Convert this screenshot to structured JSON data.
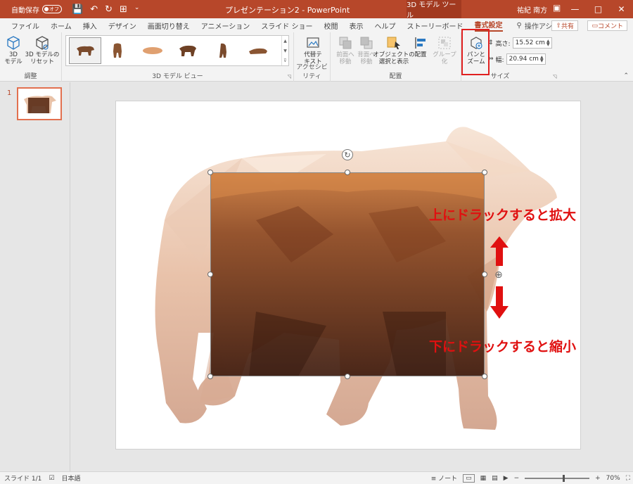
{
  "titlebar": {
    "autosave_label": "自動保存",
    "autosave_state": "オフ",
    "doc_title": "プレゼンテーション2 - PowerPoint",
    "tool_tab": "3D モデル ツール",
    "user": "祐紀 南方"
  },
  "tabs": [
    "ファイル",
    "ホーム",
    "挿入",
    "デザイン",
    "画面切り替え",
    "アニメーション",
    "スライド ショー",
    "校閲",
    "表示",
    "ヘルプ",
    "ストーリーボード",
    "書式設定"
  ],
  "active_tab": "書式設定",
  "tellme": "操作アシスト",
  "share": "共有",
  "comment": "コメント",
  "ribbon": {
    "group_adjust": "調整",
    "btn_3dmodel": "3D\nモデル",
    "btn_reset": "3D モデルの\nリセット",
    "group_views": "3D モデル ビュー",
    "group_access": "アクセシビリティ",
    "btn_alttext": "代替テ\nキスト",
    "group_arrange": "配置",
    "btn_forward": "前面へ\n移動",
    "btn_backward": "背面へ\n移動",
    "btn_selection": "オブジェクトの\n選択と表示",
    "btn_align": "配置",
    "btn_group": "グループ化",
    "btn_panzoom": "パンと\nズーム",
    "group_size": "サイズ",
    "height_label": "高さ:",
    "height_value": "15.52 cm",
    "width_label": "幅:",
    "width_value": "20.94 cm"
  },
  "thumbs": {
    "slide_number": "1"
  },
  "annotations": {
    "up": "上にドラックすると拡大",
    "down": "下にドラックすると縮小"
  },
  "status": {
    "slide": "スライド 1/1",
    "lang": "日本語",
    "notes": "ノート",
    "zoom": "70%"
  },
  "colors": {
    "accent": "#b7472a",
    "annotation": "#e01010"
  }
}
